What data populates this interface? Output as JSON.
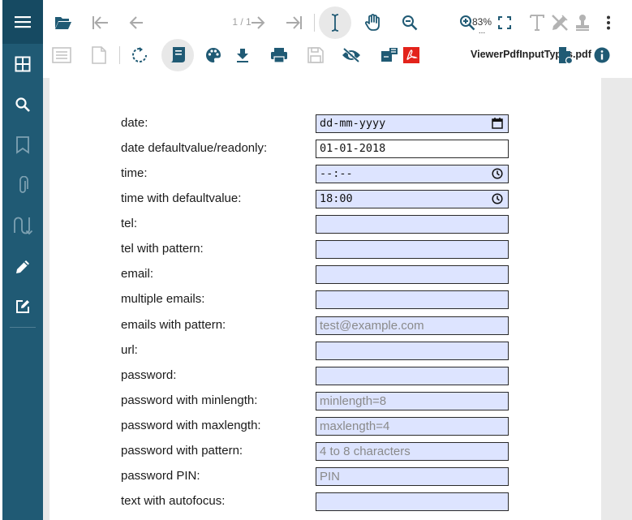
{
  "toolbar": {
    "page_indicator": "1 / 1",
    "zoom_level": "83%",
    "zoom_more": "...",
    "filename": "ViewerPdfInputTypes.pdf"
  },
  "sidebar": {
    "items": [
      {
        "icon": "menu-icon"
      },
      {
        "icon": "thumbnails-icon"
      },
      {
        "icon": "search-icon"
      },
      {
        "icon": "bookmark-icon"
      },
      {
        "icon": "attachment-icon"
      },
      {
        "icon": "article-threads-icon"
      },
      {
        "icon": "pen-icon"
      },
      {
        "icon": "form-edit-icon"
      }
    ]
  },
  "form": {
    "rows": [
      {
        "label": "date:",
        "value": "dd-mm-yyyy",
        "placeholder": "",
        "kind": "date"
      },
      {
        "label": "date defaultvalue/readonly:",
        "value": "01-01-2018",
        "placeholder": "",
        "kind": "date-readonly"
      },
      {
        "label": "time:",
        "value": "--:--",
        "placeholder": "",
        "kind": "time"
      },
      {
        "label": "time with defaultvalue:",
        "value": "18:00",
        "placeholder": "",
        "kind": "time"
      },
      {
        "label": "tel:",
        "value": "",
        "placeholder": "",
        "kind": "text"
      },
      {
        "label": "tel with pattern:",
        "value": "",
        "placeholder": "",
        "kind": "text"
      },
      {
        "label": "email:",
        "value": "",
        "placeholder": "",
        "kind": "text"
      },
      {
        "label": "multiple emails:",
        "value": "",
        "placeholder": "",
        "kind": "text"
      },
      {
        "label": "emails with pattern:",
        "value": "",
        "placeholder": "test@example.com",
        "kind": "text"
      },
      {
        "label": "url:",
        "value": "",
        "placeholder": "",
        "kind": "text"
      },
      {
        "label": "password:",
        "value": "",
        "placeholder": "",
        "kind": "text"
      },
      {
        "label": "password with minlength:",
        "value": "",
        "placeholder": "minlength=8",
        "kind": "text"
      },
      {
        "label": "password with maxlength:",
        "value": "",
        "placeholder": "maxlength=4",
        "kind": "text"
      },
      {
        "label": "password with pattern:",
        "value": "",
        "placeholder": "4 to 8 characters",
        "kind": "text"
      },
      {
        "label": "password PIN:",
        "value": "",
        "placeholder": "PIN",
        "kind": "text"
      },
      {
        "label": "text with autofocus:",
        "value": "",
        "placeholder": "",
        "kind": "text"
      }
    ]
  },
  "colors": {
    "sidebar": "#205a74",
    "sidebar_active": "#164a62",
    "field_background": "#dde4ff",
    "pdf_icon_red": "#e3231b"
  }
}
